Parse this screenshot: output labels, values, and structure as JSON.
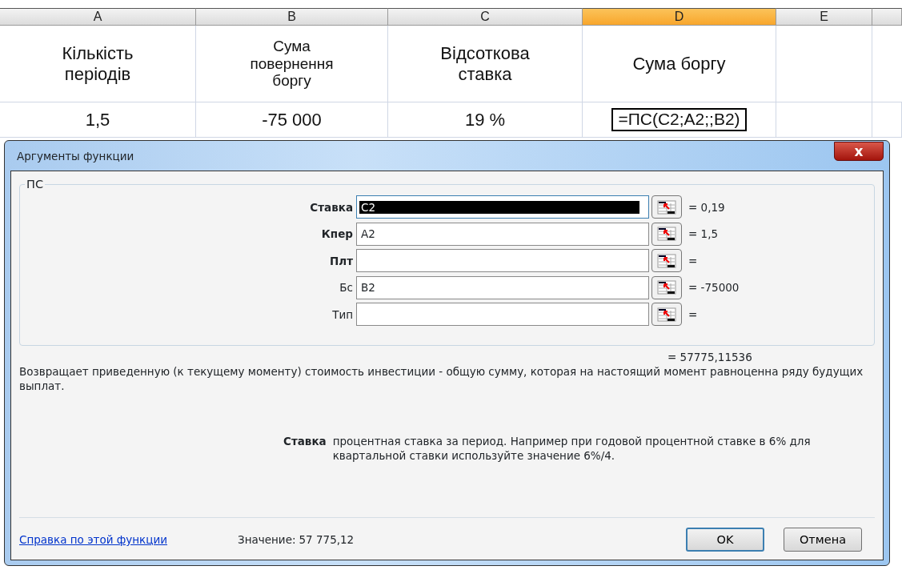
{
  "sheet": {
    "columns": [
      {
        "label": "A",
        "selected": false
      },
      {
        "label": "B",
        "selected": false
      },
      {
        "label": "C",
        "selected": false
      },
      {
        "label": "D",
        "selected": true
      },
      {
        "label": "E",
        "selected": false
      }
    ],
    "rows": [
      [
        {
          "text": "Кількість періодів",
          "editing": false
        },
        {
          "text": "Сума повернення боргу",
          "editing": false
        },
        {
          "text": "Відсоткова ставка",
          "editing": false
        },
        {
          "text": "Сума боргу",
          "editing": false
        }
      ],
      [
        {
          "text": "1,5",
          "editing": false
        },
        {
          "text": "-75 000",
          "editing": false
        },
        {
          "text": "19 %",
          "editing": false
        },
        {
          "text": "=ПС(C2;A2;;B2)",
          "editing": true
        }
      ]
    ]
  },
  "dialog": {
    "title": "Аргументы функции",
    "close": "x",
    "group": "ПС",
    "arguments": [
      {
        "label": "Ставка",
        "required": true,
        "value": "C2",
        "selected": true,
        "result": "= 0,19"
      },
      {
        "label": "Кпер",
        "required": true,
        "value": "A2",
        "selected": false,
        "result": "= 1,5"
      },
      {
        "label": "Плт",
        "required": true,
        "selected": false,
        "result": "="
      },
      {
        "label": "Бс",
        "required": false,
        "value": "B2",
        "selected": false,
        "result": "= -75000"
      },
      {
        "label": "Тип",
        "required": false,
        "selected": false,
        "result": "="
      }
    ],
    "total": "= 57775,11536",
    "description": "Возвращает приведенную (к текущему моменту) стоимость инвестиции - общую сумму, которая на настоящий момент равноценна ряду будущих выплат.",
    "arg_help": {
      "name": "Ставка",
      "text": "процентная ставка за период. Например при годовой процентной ставке в 6% для квартальной ставки используйте значение 6%/4."
    },
    "help_link": "Справка по этой функции",
    "value_label": "Значение:",
    "value": "57 775,12",
    "buttons": [
      {
        "label": "OK",
        "default": true
      },
      {
        "label": "Отмена",
        "default": false
      }
    ]
  }
}
